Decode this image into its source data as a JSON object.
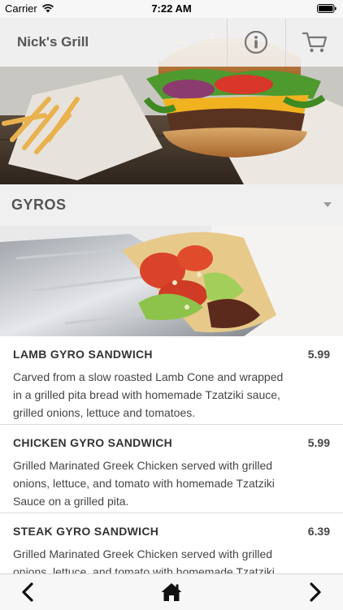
{
  "status": {
    "carrier": "Carrier",
    "time": "7:22 AM"
  },
  "header": {
    "title": "Nick's Grill",
    "icons": [
      "info-icon",
      "cart-icon"
    ]
  },
  "category": {
    "name": "GYROS"
  },
  "menu": {
    "items": [
      {
        "name": "LAMB GYRO SANDWICH",
        "price": "5.99",
        "description": "Carved from a slow roasted Lamb Cone and wrapped in a grilled pita bread with homemade Tzatziki sauce, grilled onions, lettuce and tomatoes."
      },
      {
        "name": "CHICKEN GYRO SANDWICH",
        "price": "5.99",
        "description": "Grilled Marinated Greek Chicken served with grilled onions, lettuce, and tomato with homemade Tzatziki Sauce on a grilled pita."
      },
      {
        "name": "STEAK GYRO SANDWICH",
        "price": "6.39",
        "description": "Grilled Marinated Greek Chicken served with grilled onions, lettuce, and tomato with homemade Tzatziki Sauce on a grilled pita."
      }
    ]
  },
  "toolbar": {
    "icons": [
      "chevron-left-icon",
      "home-icon",
      "chevron-right-icon"
    ]
  },
  "colors": {
    "header_bg": "#f5f5f5",
    "category_bg": "#f0f0f0",
    "text": "#333333",
    "divider": "#d9d9d9"
  }
}
